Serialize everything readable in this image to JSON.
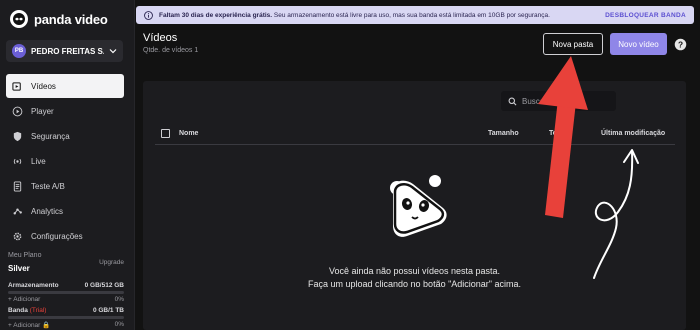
{
  "app": {
    "name": "panda video"
  },
  "user": {
    "initials": "PB",
    "name": "PEDRO FREITAS S..."
  },
  "nav": {
    "items": [
      {
        "label": "Vídeos",
        "icon": "videos-icon",
        "active": true
      },
      {
        "label": "Player",
        "icon": "player-icon",
        "active": false
      },
      {
        "label": "Segurança",
        "icon": "shield-icon",
        "active": false
      },
      {
        "label": "Live",
        "icon": "live-icon",
        "active": false
      },
      {
        "label": "Teste A/B",
        "icon": "ab-test-icon",
        "active": false
      },
      {
        "label": "Analytics",
        "icon": "analytics-icon",
        "active": false
      },
      {
        "label": "Configurações",
        "icon": "gear-icon",
        "active": false
      }
    ]
  },
  "plan": {
    "label": "Meu Plano",
    "name": "Silver",
    "upgrade": "Upgrade",
    "storage": {
      "label": "Armazenamento",
      "value": "0 GB/512 GB",
      "add": "+ Adicionar",
      "percent_label": "0%",
      "percent": 0
    },
    "bandwidth": {
      "label": "Banda",
      "tag": "(Trial)",
      "value": "0 GB/1 TB",
      "add": "+ Adicionar",
      "percent_label": "0%",
      "percent": 0
    }
  },
  "banner": {
    "bold": "Faltam 30 dias de experiência grátis.",
    "text": " Seu armazenamento está livre para uso, mas sua banda está limitada em 10GB por segurança.",
    "action": "DESBLOQUEAR BANDA"
  },
  "header": {
    "title": "Vídeos",
    "count": "Qtde. de vídeos 1",
    "new_folder": "Nova pasta",
    "new_video": "Novo vídeo"
  },
  "table": {
    "search_placeholder": "Buscar",
    "columns": {
      "name": "Nome",
      "size": "Tamanho",
      "time": "Tempo",
      "modified": "Última modificação"
    }
  },
  "empty": {
    "line1": "Você ainda não possui vídeos nesta pasta.",
    "line2": "Faça um upload clicando no botão \"Adicionar\" acima."
  },
  "colors": {
    "accent": "#8f86e8",
    "arrow": "#e8413a",
    "banner": "#d9d7f3"
  }
}
